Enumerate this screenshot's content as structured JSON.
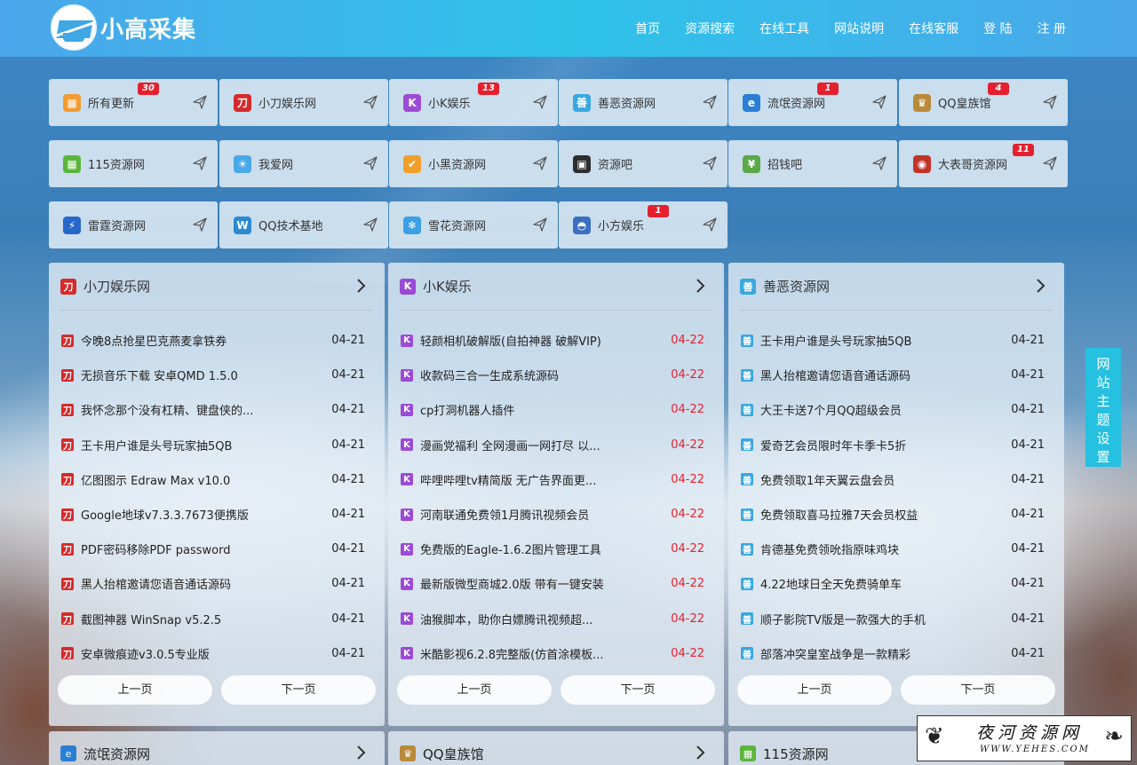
{
  "brand": {
    "name": "小高采集"
  },
  "nav": [
    "首页",
    "资源搜索",
    "在线工具",
    "网站说明",
    "在线客服",
    "登 陆",
    "注 册"
  ],
  "tiles": [
    {
      "name": "所有更新",
      "icon": "grid-colorful-icon",
      "color": "#f29b32",
      "badge": "30"
    },
    {
      "name": "小刀娱乐网",
      "icon": "xiaodao-logo-icon",
      "color": "#d62a2a",
      "badge": ""
    },
    {
      "name": "小K娱乐",
      "icon": "k-logo-icon",
      "color": "#9b4bd6",
      "badge": "13"
    },
    {
      "name": "善恶资源网",
      "icon": "shan-e-logo-icon",
      "color": "#3aa7e0",
      "badge": ""
    },
    {
      "name": "流氓资源网",
      "icon": "globe-logo-icon",
      "color": "#2a7fd4",
      "badge": "1"
    },
    {
      "name": "QQ皇族馆",
      "icon": "crown-logo-icon",
      "color": "#b88a3a",
      "badge": "4"
    },
    {
      "name": "115资源网",
      "icon": "grid-green-icon",
      "color": "#5bb53b",
      "badge": ""
    },
    {
      "name": "我爱网",
      "icon": "sun-logo-icon",
      "color": "#49a9e6",
      "badge": ""
    },
    {
      "name": "小黑资源网",
      "icon": "shield-check-icon",
      "color": "#f0a02a",
      "badge": ""
    },
    {
      "name": "资源吧",
      "icon": "box-logo-icon",
      "color": "#2d2d2d",
      "badge": ""
    },
    {
      "name": "招钱吧",
      "icon": "money-logo-icon",
      "color": "#5aa846",
      "badge": ""
    },
    {
      "name": "大表哥资源网",
      "icon": "round-seal-icon",
      "color": "#c2332a",
      "badge": "11"
    },
    {
      "name": "雷霆资源网",
      "icon": "lightning-logo-icon",
      "color": "#2767c9",
      "badge": ""
    },
    {
      "name": "QQ技术基地",
      "icon": "w-logo-icon",
      "color": "#2c8ad0",
      "badge": ""
    },
    {
      "name": "雪花资源网",
      "icon": "snowflake-icon",
      "color": "#3aa0e6",
      "badge": ""
    },
    {
      "name": "小方娱乐",
      "icon": "hat-logo-icon",
      "color": "#3a6fc4",
      "badge": "1"
    }
  ],
  "panels": [
    {
      "title": "小刀娱乐网",
      "icon": "xiaodao-logo-icon",
      "color": "#d62a2a",
      "date_color": "normal",
      "items": [
        {
          "title": "今晚8点抢星巴克燕麦拿铁券",
          "date": "04-21"
        },
        {
          "title": "无损音乐下载 安卓QMD 1.5.0",
          "date": "04-21"
        },
        {
          "title": "我怀念那个没有杠精、键盘侠的...",
          "date": "04-21"
        },
        {
          "title": "王卡用户谁是头号玩家抽5QB",
          "date": "04-21"
        },
        {
          "title": "亿图图示 Edraw Max v10.0",
          "date": "04-21"
        },
        {
          "title": "Google地球v7.3.3.7673便携版",
          "date": "04-21"
        },
        {
          "title": "PDF密码移除PDF password",
          "date": "04-21"
        },
        {
          "title": "黑人抬棺邀请您语音通话源码",
          "date": "04-21"
        },
        {
          "title": "截图神器 WinSnap v5.2.5",
          "date": "04-21"
        },
        {
          "title": "安卓微痕迹v3.0.5专业版",
          "date": "04-21"
        }
      ],
      "prev": "上一页",
      "next": "下一页"
    },
    {
      "title": "小K娱乐",
      "icon": "k-logo-icon",
      "color": "#9b4bd6",
      "date_color": "red",
      "items": [
        {
          "title": "轻颜相机破解版(自拍神器 破解VIP)",
          "date": "04-22"
        },
        {
          "title": "收款码三合一生成系统源码",
          "date": "04-22"
        },
        {
          "title": "cp打洞机器人插件",
          "date": "04-22"
        },
        {
          "title": "漫画党福利 全网漫画一网打尽 以...",
          "date": "04-22"
        },
        {
          "title": "哔哩哔哩tv精简版 无广告界面更...",
          "date": "04-22"
        },
        {
          "title": "河南联通免费领1月腾讯视频会员",
          "date": "04-22"
        },
        {
          "title": "免费版的Eagle-1.6.2图片管理工具",
          "date": "04-22"
        },
        {
          "title": "最新版微型商城2.0版 带有一键安装",
          "date": "04-22"
        },
        {
          "title": "油猴脚本，助你白嫖腾讯视频超...",
          "date": "04-22"
        },
        {
          "title": "米酷影视6.2.8完整版(仿首涂模板...",
          "date": "04-22"
        }
      ],
      "prev": "上一页",
      "next": "下一页"
    },
    {
      "title": "善恶资源网",
      "icon": "shan-e-logo-icon",
      "color": "#3aa7e0",
      "date_color": "normal",
      "items": [
        {
          "title": "王卡用户谁是头号玩家抽5QB",
          "date": "04-21"
        },
        {
          "title": "黑人抬棺邀请您语音通话源码",
          "date": "04-21"
        },
        {
          "title": "大王卡送7个月QQ超级会员",
          "date": "04-21"
        },
        {
          "title": "爱奇艺会员限时年卡季卡5折",
          "date": "04-21"
        },
        {
          "title": "免费领取1年天翼云盘会员",
          "date": "04-21"
        },
        {
          "title": "免费领取喜马拉雅7天会员权益",
          "date": "04-21"
        },
        {
          "title": "肯德基免费领吮指原味鸡块",
          "date": "04-21"
        },
        {
          "title": "4.22地球日全天免费骑单车",
          "date": "04-21"
        },
        {
          "title": "顺子影院TV版是一款强大的手机",
          "date": "04-21"
        },
        {
          "title": "部落冲突皇室战争是一款精彩",
          "date": "04-21"
        }
      ],
      "prev": "上一页",
      "next": "下一页"
    }
  ],
  "bottom_panels": [
    {
      "title": "流氓资源网",
      "icon": "globe-logo-icon",
      "color": "#2a7fd4"
    },
    {
      "title": "QQ皇族馆",
      "icon": "crown-logo-icon",
      "color": "#b88a3a"
    },
    {
      "title": "115资源网",
      "icon": "grid-green-icon",
      "color": "#5bb53b"
    }
  ],
  "theme_tab": [
    "网",
    "站",
    "主",
    "题",
    "设",
    "置"
  ],
  "watermark": {
    "cn": "夜河资源网",
    "en": "WWW.YEHES.COM"
  }
}
